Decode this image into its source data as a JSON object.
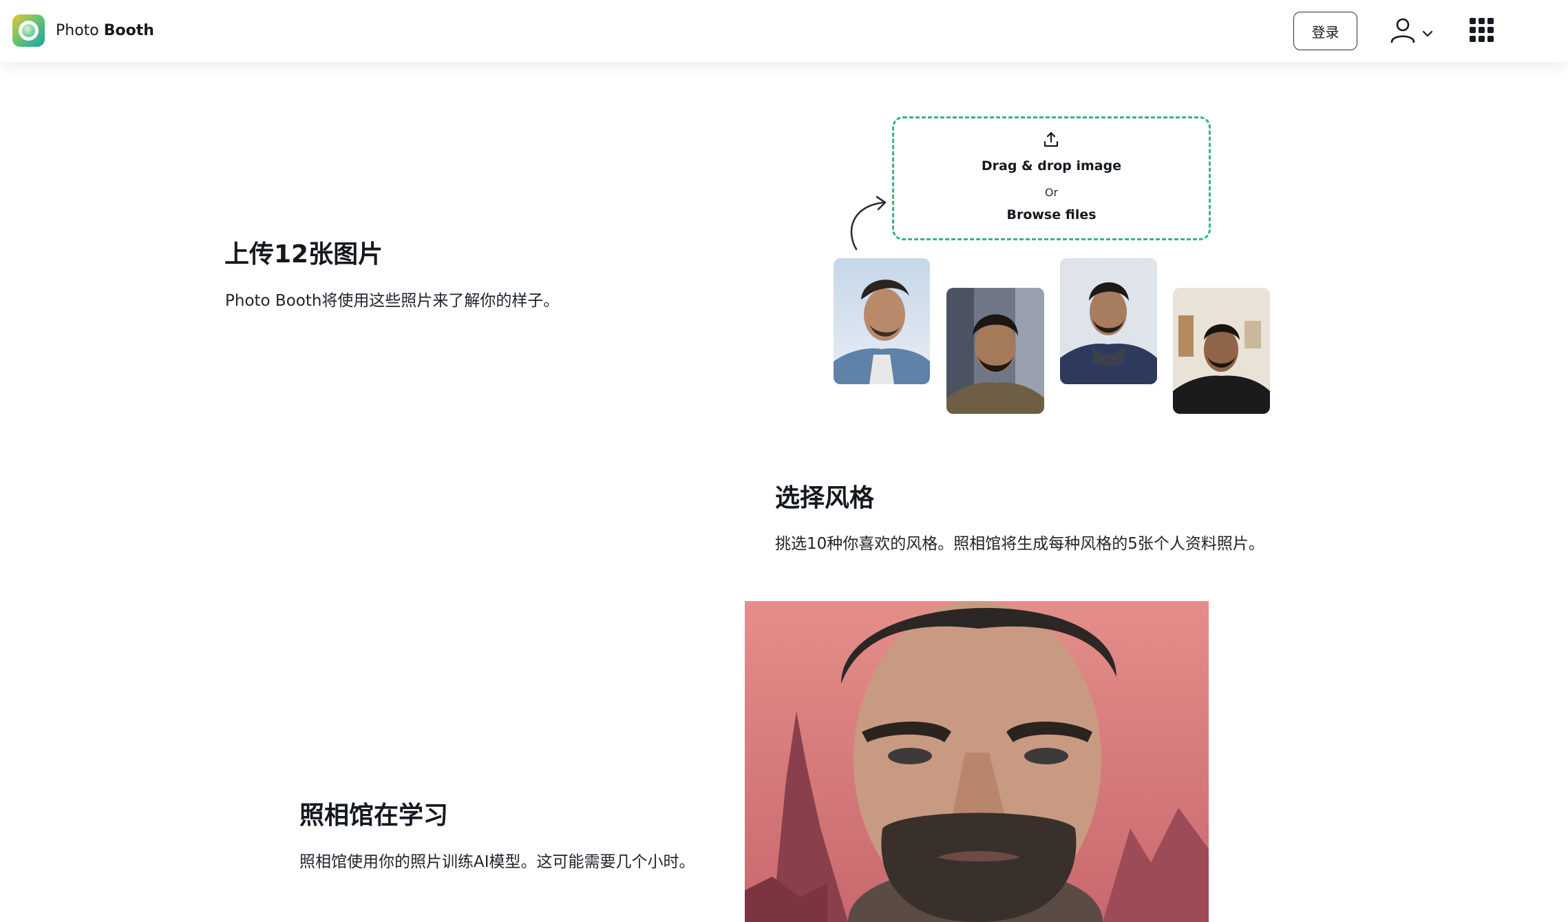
{
  "header": {
    "logo_light": "Photo",
    "logo_bold": "Booth",
    "login_label": "登录"
  },
  "steps": [
    {
      "title": "上传12张图片",
      "desc": "Photo Booth将使用这些照片来了解你的样子。"
    },
    {
      "title": "选择风格",
      "desc": "挑选10种你喜欢的风格。照相馆将生成每种风格的5张个人资料照片。"
    },
    {
      "title": "照相馆在学习",
      "desc": "照相馆使用你的照片训练AI模型。这可能需要几个小时。"
    }
  ],
  "upload": {
    "drag_text": "Drag & drop image",
    "or_text": "Or",
    "browse_text": "Browse files"
  },
  "icons": {
    "logo": "photo-booth-logo-icon",
    "user": "user-icon",
    "chevron": "chevron-down-icon",
    "apps": "apps-grid-icon",
    "upload": "upload-icon",
    "arrow": "curved-arrow-icon"
  },
  "colors": {
    "accent_dashed": "#35b77a",
    "text": "#14181f"
  }
}
